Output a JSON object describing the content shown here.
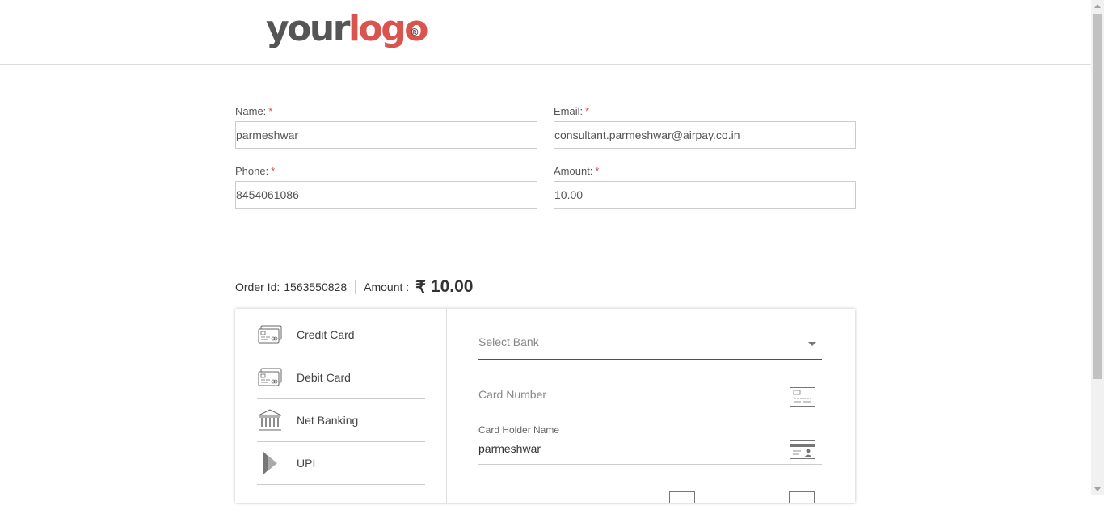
{
  "header": {
    "logo_word1": "your",
    "logo_word2": "logo",
    "logo_mark": "®"
  },
  "form": {
    "name_label": "Name:",
    "email_label": "Email:",
    "phone_label": "Phone:",
    "amount_label": "Amount:",
    "required_mark": "*",
    "name_value": "parmeshwar",
    "email_value": "consultant.parmeshwar@airpay.co.in",
    "phone_value": "8454061086",
    "amount_value": "10.00"
  },
  "order": {
    "order_id_label": "Order Id:",
    "order_id": "1563550828",
    "amount_label": "Amount :",
    "currency_symbol": "₹",
    "amount": "10.00"
  },
  "payment_methods": [
    {
      "label": "Credit Card",
      "icon": "credit-card-icon"
    },
    {
      "label": "Debit Card",
      "icon": "debit-card-icon"
    },
    {
      "label": "Net Banking",
      "icon": "bank-icon"
    },
    {
      "label": "UPI",
      "icon": "upi-icon"
    }
  ],
  "card_form": {
    "select_bank_placeholder": "Select Bank",
    "card_number_placeholder": "Card Number",
    "card_holder_label": "Card Holder Name",
    "card_holder_value": "parmeshwar"
  },
  "colors": {
    "accent": "#d9534f",
    "underline": "#b22222",
    "logo_gray": "#555555"
  }
}
